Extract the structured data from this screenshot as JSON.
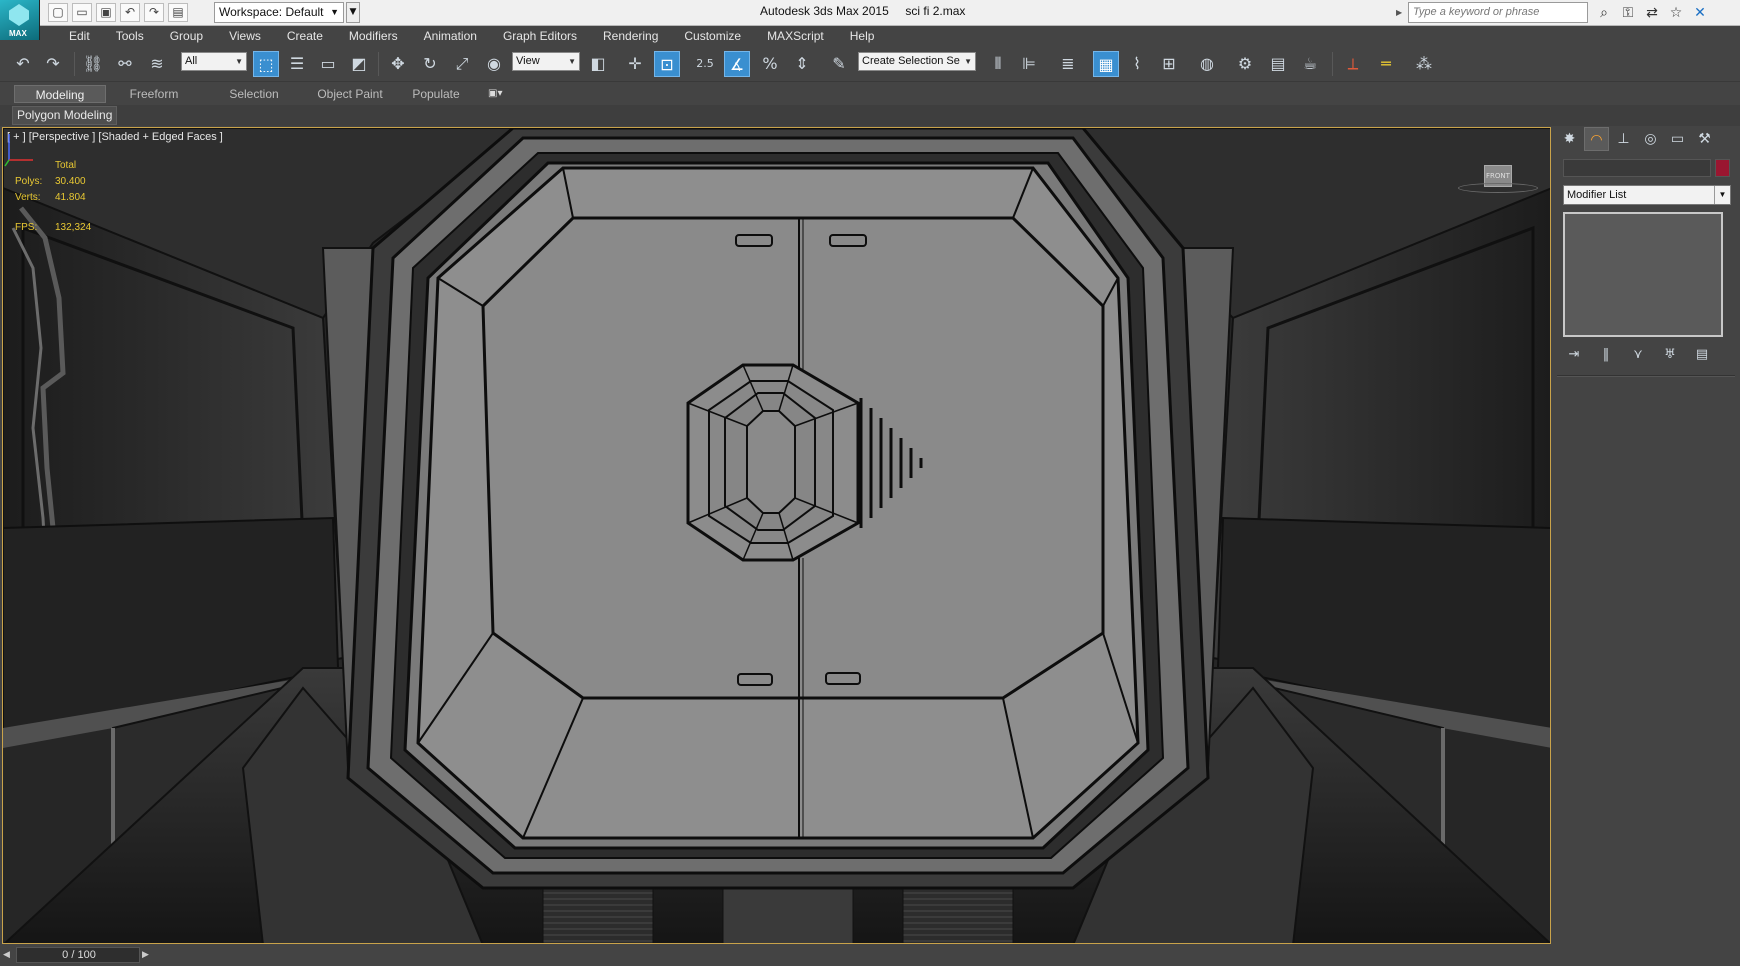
{
  "title_bar": {
    "workspace": "Workspace: Default",
    "app_name": "Autodesk 3ds Max  2015",
    "file_name": "sci fi 2.max",
    "search_placeholder": "Type a keyword or phrase",
    "logo_text": "MAX"
  },
  "menu": [
    "Edit",
    "Tools",
    "Group",
    "Views",
    "Create",
    "Modifiers",
    "Animation",
    "Graph Editors",
    "Rendering",
    "Customize",
    "MAXScript",
    "Help"
  ],
  "toolbar": {
    "selection_filter": "All",
    "ref_coord": "View",
    "snap_label": "2.5",
    "named_selection_placeholder": "Create Selection Se"
  },
  "ribbon": {
    "tabs": [
      "Modeling",
      "Freeform",
      "Selection",
      "Object Paint",
      "Populate"
    ],
    "active_tab": "Modeling",
    "panel_label": "Polygon Modeling"
  },
  "viewport": {
    "label": "[ + ] [Perspective ] [Shaded + Edged Faces ]",
    "stats": {
      "header": "Total",
      "polys_label": "Polys:",
      "polys": "30.400",
      "verts_label": "Verts:",
      "verts": "41.804",
      "fps_label": "FPS:",
      "fps": "132,324"
    },
    "viewcube_label": "FRONT",
    "border_color": "#c9a34a"
  },
  "command_panel": {
    "modifier_list": "Modifier List",
    "object_color": "#9a1630"
  },
  "timeslider": {
    "frame": "0 / 100"
  },
  "colors": {
    "accent": "#3a8fd0",
    "ui_background": "#444444",
    "stats_text": "#e8c833"
  }
}
